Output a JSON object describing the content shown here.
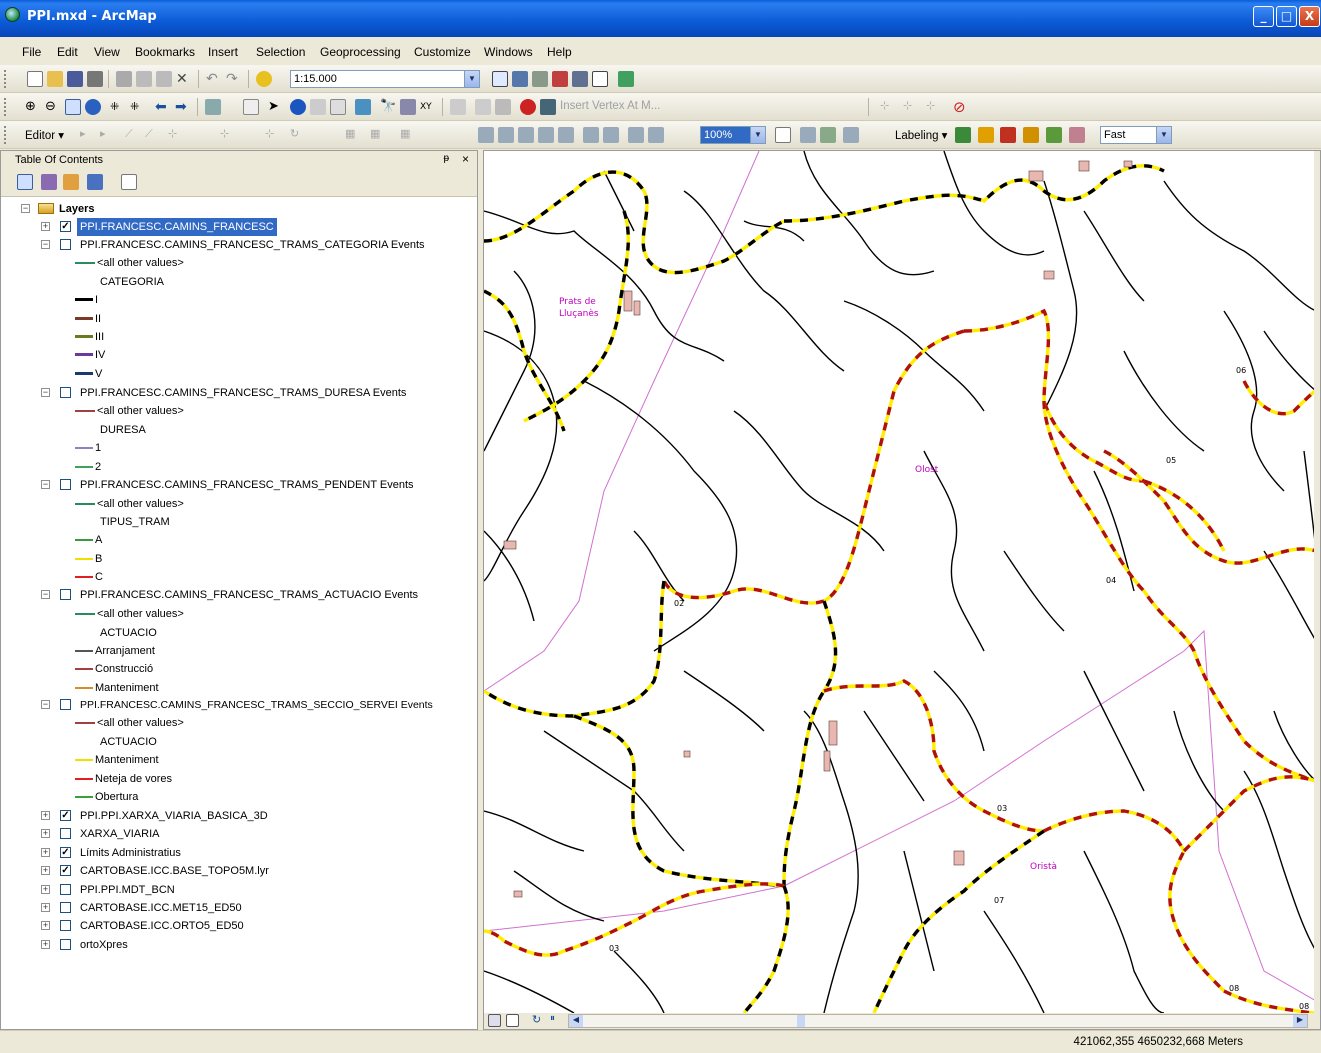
{
  "window": {
    "title": "PPI.mxd - ArcMap",
    "minimize": "_",
    "maximize": "□",
    "close": "X"
  },
  "menu": [
    "File",
    "Edit",
    "View",
    "Bookmarks",
    "Insert",
    "Selection",
    "Geoprocessing",
    "Customize",
    "Windows",
    "Help"
  ],
  "toolbar1": {
    "scale": "1:15.000"
  },
  "toolbar2": {
    "insert_vertex": "Insert Vertex At M..."
  },
  "toolbar3": {
    "editor": "Editor ▾",
    "zoom": "100%",
    "labeling": "Labeling ▾",
    "label_mode": "Fast"
  },
  "toc": {
    "title": "Table Of Contents",
    "pin": "ᵽ",
    "close": "×",
    "root": "Layers",
    "items": [
      {
        "label": "PPI.FRANCESC.CAMINS_FRANCESC",
        "checked": true,
        "selected": true
      },
      {
        "label": "PPI.FRANCESC.CAMINS_FRANCESC_TRAMS_CATEGORIA Events",
        "checked": false
      },
      {
        "label": "<all other values>"
      },
      {
        "label": "CATEGORIA"
      },
      {
        "label": "I"
      },
      {
        "label": "II"
      },
      {
        "label": "III"
      },
      {
        "label": "IV"
      },
      {
        "label": "V"
      },
      {
        "label": "PPI.FRANCESC.CAMINS_FRANCESC_TRAMS_DURESA Events",
        "checked": false
      },
      {
        "label": "<all other values>"
      },
      {
        "label": "DURESA"
      },
      {
        "label": "1"
      },
      {
        "label": "2"
      },
      {
        "label": "PPI.FRANCESC.CAMINS_FRANCESC_TRAMS_PENDENT Events",
        "checked": false
      },
      {
        "label": "<all other values>"
      },
      {
        "label": "TIPUS_TRAM"
      },
      {
        "label": "A"
      },
      {
        "label": "B"
      },
      {
        "label": "C"
      },
      {
        "label": "PPI.FRANCESC.CAMINS_FRANCESC_TRAMS_ACTUACIO Events",
        "checked": false
      },
      {
        "label": "<all other values>"
      },
      {
        "label": "ACTUACIO"
      },
      {
        "label": "Arranjament"
      },
      {
        "label": "Construcció"
      },
      {
        "label": "Manteniment"
      },
      {
        "label": "PPI.FRANCESC.CAMINS_FRANCESC_TRAMS_SECCIO_SERVEI Events",
        "checked": false
      },
      {
        "label": "<all other values>"
      },
      {
        "label": "ACTUACIO"
      },
      {
        "label": "Manteniment"
      },
      {
        "label": "Neteja de vores"
      },
      {
        "label": "Obertura"
      },
      {
        "label": "PPI.PPI.XARXA_VIARIA_BASICA_3D",
        "checked": true
      },
      {
        "label": "XARXA_VIARIA",
        "checked": false
      },
      {
        "label": "Límits Administratius",
        "checked": true
      },
      {
        "label": "CARTOBASE.ICC.BASE_TOPO5M.lyr",
        "checked": true
      },
      {
        "label": "PPI.PPI.MDT_BCN",
        "checked": false
      },
      {
        "label": "CARTOBASE.ICC.MET15_ED50",
        "checked": false
      },
      {
        "label": "CARTOBASE.ICC.ORTO5_ED50",
        "checked": false
      },
      {
        "label": "ortoXpres",
        "checked": false
      }
    ]
  },
  "map": {
    "labels": {
      "prats_1": "Prats de",
      "prats_2": "Lluçanès",
      "olost": "Olost",
      "orista": "Oristà"
    },
    "road_codes": [
      "02",
      "03",
      "03",
      "04",
      "05",
      "06",
      "07",
      "08",
      "08"
    ],
    "colors": {
      "dashed_yellow": "#ffee00",
      "dashed_black": "#000000",
      "dashed_red": "#b01010",
      "boundary": "#d070d0",
      "town_label": "#c000c0"
    }
  },
  "status": {
    "coords": "421062,355  4650232,668 Meters"
  }
}
